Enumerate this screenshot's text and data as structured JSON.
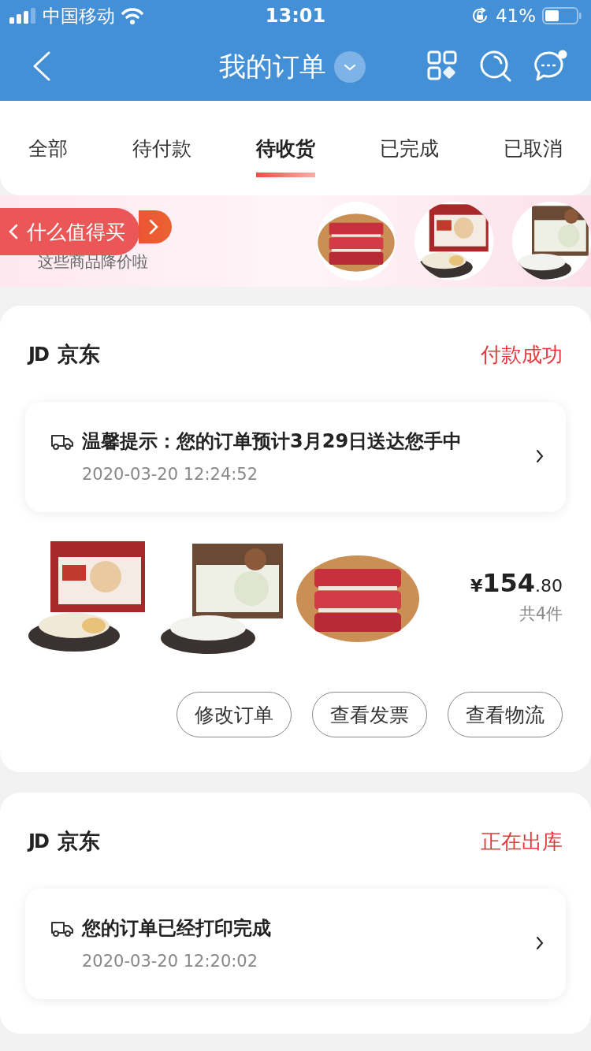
{
  "status_bar": {
    "carrier": "中国移动",
    "time": "13:01",
    "battery": "41%"
  },
  "nav": {
    "title": "我的订单"
  },
  "tabs": [
    {
      "label": "全部",
      "selected": false
    },
    {
      "label": "待付款",
      "selected": false
    },
    {
      "label": "待收货",
      "selected": true
    },
    {
      "label": "已完成",
      "selected": false
    },
    {
      "label": "已取消",
      "selected": false
    }
  ],
  "banner": {
    "subtitle": "这些商品降价啦",
    "back_pill": "什么值得买"
  },
  "orders": [
    {
      "shop_logo": "JD",
      "shop": "京东",
      "status": "付款成功",
      "notice": "温馨提示：您的订单预计3月29日送达您手中",
      "time": "2020-03-20 12:24:52",
      "price": {
        "currency": "¥",
        "amount": "154",
        "cents": ".80"
      },
      "count": "共4件",
      "buttons": [
        "修改订单",
        "查看发票",
        "查看物流"
      ]
    },
    {
      "shop_logo": "JD",
      "shop": "京东",
      "status": "正在出库",
      "notice": "您的订单已经打印完成",
      "time": "2020-03-20 12:20:02"
    }
  ]
}
